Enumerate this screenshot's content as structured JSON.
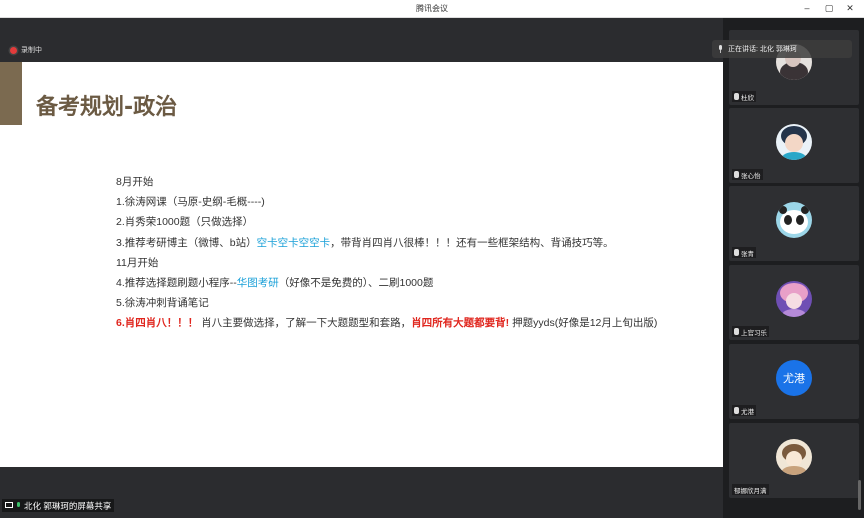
{
  "window": {
    "title": "腾讯会议",
    "minimize": "–",
    "maximize": "▢",
    "close": "✕"
  },
  "recording": {
    "label": "录制中"
  },
  "slide": {
    "heading": "备考规划-政治",
    "lines": {
      "l1": "8月开始",
      "l2": "1.徐涛网课（马原-史纲-毛概----)",
      "l3": "2.肖秀荣1000题（只做选择）",
      "l4a": "3.推荐考研博主（微博、b站）",
      "l4b": "空卡空卡空空卡",
      "l4c": "，带背肖四肖八很棒！！！还有一些框架结构、背诵技巧等。",
      "l5": "11月开始",
      "l6a": "4.推荐选择题刷题小程序--",
      "l6b": "华图考研",
      "l6c": "（好像不是免费的）、二刷1000题",
      "l7": "5.徐涛冲刺背诵笔记",
      "l8a": "6.",
      "l8b": "肖四肖八！！！",
      "l8c": "肖八主要做选择，了解一下大题题型和套路，",
      "l8d": "肖四所有大题都要背!",
      "l8e": "押题yyds(好像是12月上旬出版)"
    }
  },
  "share": {
    "label": "北化 郭琳珂的屏幕共享"
  },
  "speaking": {
    "label": "正在讲话: 北化 郭琳珂"
  },
  "participants": [
    {
      "name": "杜欣",
      "initial": ""
    },
    {
      "name": "张心怡",
      "initial": ""
    },
    {
      "name": "张青",
      "initial": ""
    },
    {
      "name": "上官习乐",
      "initial": ""
    },
    {
      "name": "尤港",
      "initial": "尤港"
    },
    {
      "name": "郁娜欣月满",
      "initial": ""
    }
  ],
  "colors": {
    "accent_bar": "#7b6a50",
    "heading": "#6b5a43",
    "link_blue": "#1aa0d8",
    "emphasis_red": "#e0261e",
    "avatar_blue": "#1a73e8"
  }
}
